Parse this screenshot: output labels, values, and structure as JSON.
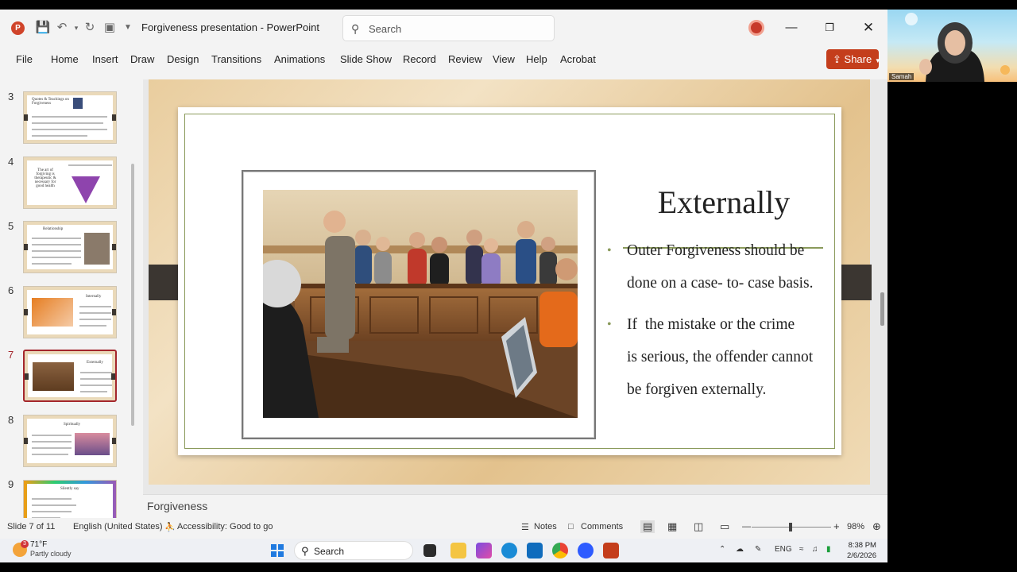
{
  "window": {
    "doc_title": "Forgiveness presentation  -  PowerPoint",
    "search_placeholder": "Search",
    "app_logo": "P"
  },
  "ribbon": {
    "file": "File",
    "tabs": [
      "Home",
      "Insert",
      "Draw",
      "Design",
      "Transitions",
      "Animations",
      "Slide Show",
      "Record",
      "Review",
      "View",
      "Help",
      "Acrobat"
    ],
    "share_label": "Share"
  },
  "thumbnails": [
    {
      "num": "3",
      "title": "Quotes & Teachings on Forgiveness"
    },
    {
      "num": "4",
      "title": "The art of forgiving is therapeutic & necessary for good health"
    },
    {
      "num": "5",
      "title": "Relationship"
    },
    {
      "num": "6",
      "title": "Internally"
    },
    {
      "num": "7",
      "title": "Externally"
    },
    {
      "num": "8",
      "title": "Spiritually"
    },
    {
      "num": "9",
      "title": "Silently say"
    }
  ],
  "slide": {
    "title": "Externally",
    "bullets": [
      [
        "Outer Forgiveness should be",
        "done on a case- to- case basis."
      ],
      [
        "If  the mistake or the crime",
        "is serious, the offender cannot",
        "be forgiven externally."
      ]
    ]
  },
  "notes": "Forgiveness",
  "status": {
    "slide_counter": "Slide 7 of 11",
    "language": "English (United States)",
    "accessibility": "Accessibility: Good to go",
    "notes_btn": "Notes",
    "comments_btn": "Comments",
    "zoom": "98%"
  },
  "webcam": {
    "name": "Samah"
  },
  "taskbar": {
    "weather_temp": "71°F",
    "weather_desc": "Partly cloudy",
    "weather_badge": "3",
    "search_label": "Search",
    "lang": "ENG",
    "time": "8:38 PM",
    "date": "2/6/2026"
  },
  "colors": {
    "accent": "#c43e1c",
    "slide_rule": "#8a9a5b",
    "selected_thumb": "#a4262c"
  }
}
